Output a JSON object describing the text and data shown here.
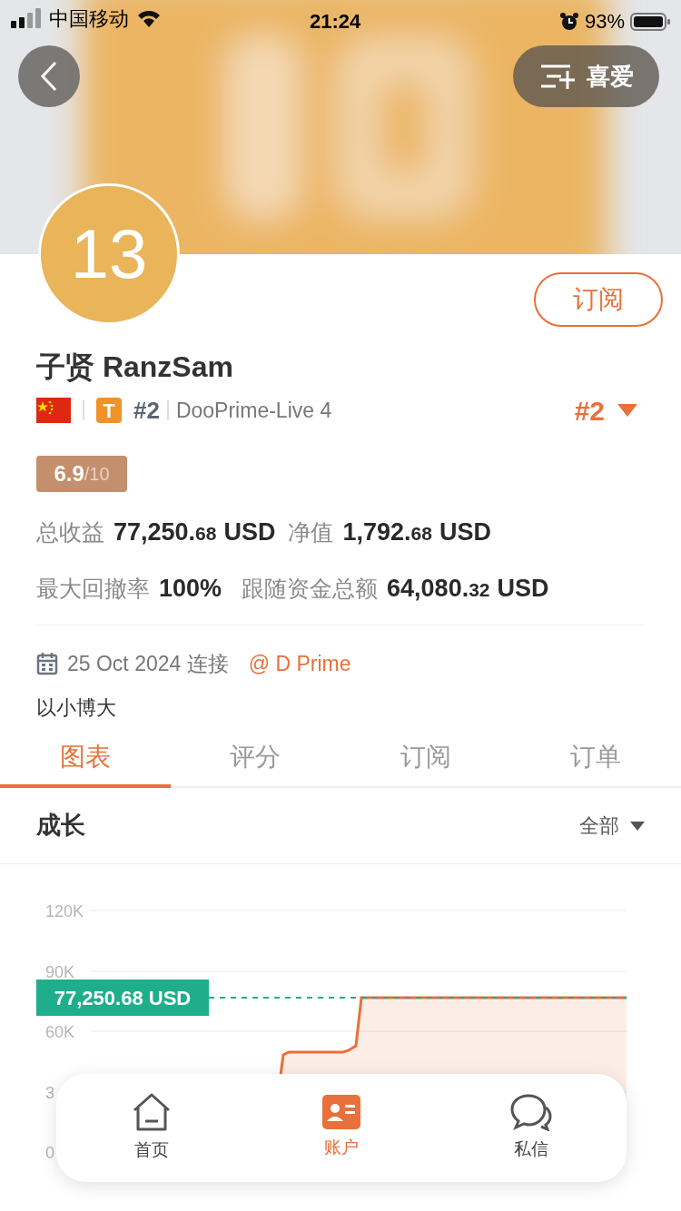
{
  "status_bar": {
    "carrier": "中国移动",
    "time": "21:24",
    "battery": "93%"
  },
  "header": {
    "favorite_button": {
      "label": "喜爱"
    }
  },
  "profile": {
    "avatar": "13",
    "subscribe_button": "订阅",
    "name": "子贤 RanzSam",
    "badge": "T",
    "rank": "#2",
    "server": "DooPrime-Live 4",
    "rank_dropdown": "#2",
    "score": {
      "value": "6.9",
      "max": "/10"
    },
    "stats": [
      {
        "label": "总收益",
        "whole": "77,250.",
        "fraction": "68",
        "unit": "USD"
      },
      {
        "label": "净值",
        "whole": "1,792.",
        "fraction": "68",
        "unit": "USD"
      },
      {
        "label": "最大回撤率",
        "whole": "100%"
      },
      {
        "label": "跟随资金总额",
        "whole": "64,080.",
        "fraction": "32",
        "unit": "USD"
      }
    ],
    "joined": "25 Oct 2024 连接",
    "broker": "@ D Prime",
    "bio": "以小博大"
  },
  "tabs": [
    {
      "label": "图表",
      "selected": true
    },
    {
      "label": "评分",
      "selected": false
    },
    {
      "label": "订阅",
      "selected": false
    },
    {
      "label": "订单",
      "selected": false
    }
  ],
  "growth": {
    "title": "成长",
    "filter": "全部",
    "price_tag": "77,250.68 USD",
    "axis_labels": [
      "120K",
      "90K",
      "60K",
      "3",
      "0"
    ]
  },
  "bottom_nav": [
    {
      "label": "首页",
      "selected": false
    },
    {
      "label": "账户",
      "selected": true
    },
    {
      "label": "私信",
      "selected": false
    }
  ]
}
